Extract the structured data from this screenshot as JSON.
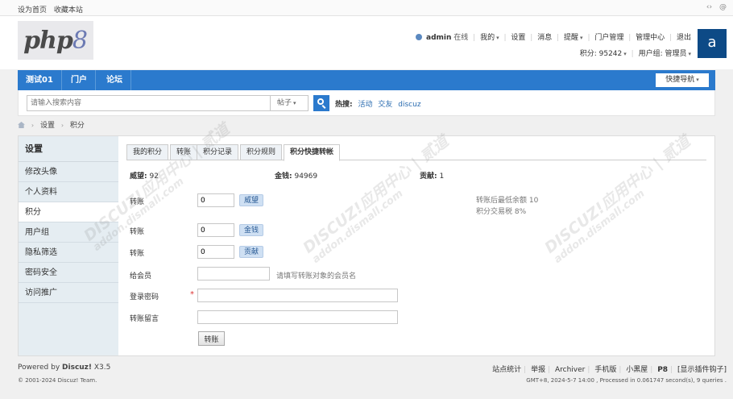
{
  "topbar": {
    "set_home": "设为首页",
    "bookmark": "收藏本站",
    "icons": [
      "code-icon",
      "at-icon"
    ],
    "code_glyph": "‹›",
    "at_glyph": "@"
  },
  "header": {
    "logo_text": "php",
    "logo_num": "8",
    "user": {
      "name": "admin",
      "status": "在线",
      "links": [
        "我的",
        "设置",
        "消息",
        "提醒",
        "门户管理",
        "管理中心",
        "退出"
      ],
      "credits_label": "积分: 95242",
      "group_label": "用户组: 管理员"
    },
    "avatar_letter": "a"
  },
  "nav": {
    "items": [
      "测试01",
      "门户",
      "论坛"
    ],
    "quick_nav": "快捷导航"
  },
  "search": {
    "placeholder": "请输入搜索内容",
    "type": "帖子",
    "hot_label": "热搜:",
    "hot_words": [
      "活动",
      "交友",
      "discuz"
    ]
  },
  "breadcrumb": {
    "items": [
      "设置",
      "积分"
    ]
  },
  "sidebar": {
    "title": "设置",
    "items": [
      "修改头像",
      "个人资料",
      "积分",
      "用户组",
      "隐私筛选",
      "密码安全",
      "访问推广"
    ],
    "active_index": 2
  },
  "tabs": {
    "items": [
      "我的积分",
      "转账",
      "积分记录",
      "积分规则",
      "积分快捷转帐"
    ],
    "active_index": 4
  },
  "summary": {
    "weiwang_label": "威望:",
    "weiwang_value": "92",
    "jinqian_label": "金钱:",
    "jinqian_value": "94969",
    "gongxian_label": "贡献:",
    "gongxian_value": "1"
  },
  "form": {
    "rows": [
      {
        "label": "转账",
        "value": "0",
        "unit": "威望"
      },
      {
        "label": "转账",
        "value": "0",
        "unit": "金钱"
      },
      {
        "label": "转账",
        "value": "0",
        "unit": "贡献"
      }
    ],
    "min_balance": "转账后最低余额 10",
    "tax": "积分交易税 8%",
    "to_member_label": "给会员",
    "to_member_hint": "请填写转账对象的会员名",
    "password_label": "登录密码",
    "required_mark": "*",
    "message_label": "转账留言",
    "submit": "转账"
  },
  "watermark": {
    "big": "DISCUZ!应用中心 | 贰道",
    "small": "addon.dismall.com"
  },
  "footer": {
    "powered_prefix": "Powered by ",
    "powered_brand": "Discuz!",
    "powered_version": " X3.5",
    "copyright": "© 2001-2024 Discuz! Team.",
    "links": [
      "站点统计",
      "举报",
      "Archiver",
      "手机版",
      "小黑屋",
      "P8",
      "[显示插件钩子]"
    ],
    "stats": "GMT+8, 2024-5-7 14:00 , Processed in 0.061747 second(s), 9 queries ."
  }
}
